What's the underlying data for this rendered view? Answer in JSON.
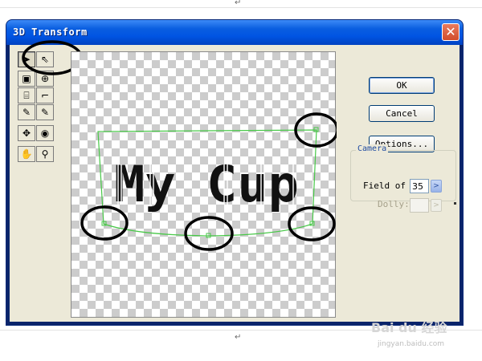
{
  "document": {
    "return_mark_top": "↵",
    "return_mark_bottom": "↵"
  },
  "window": {
    "title": "3D Transform",
    "close_icon": "close-x-icon"
  },
  "toolbox": {
    "tools": [
      {
        "name": "selection-arrow-icon",
        "glyph": "➤",
        "pressed": true
      },
      {
        "name": "direct-select-arrow-icon",
        "glyph": "⇖",
        "pressed": false
      },
      {
        "name": "cube-icon",
        "glyph": "▣",
        "pressed": false
      },
      {
        "name": "sphere-icon",
        "glyph": "⊕",
        "pressed": false
      },
      {
        "name": "cylinder-icon",
        "glyph": "⌸",
        "pressed": false
      },
      {
        "name": "bend-icon",
        "glyph": "⌐",
        "pressed": false
      },
      {
        "name": "pen-add-icon",
        "glyph": "✎",
        "pressed": false
      },
      {
        "name": "pen-remove-icon",
        "glyph": "✎",
        "pressed": false
      },
      {
        "name": "rotate-icon",
        "glyph": "✥",
        "pressed": false
      },
      {
        "name": "orbit-icon",
        "glyph": "◉",
        "pressed": false
      },
      {
        "name": "hand-icon",
        "glyph": "✋",
        "pressed": false
      },
      {
        "name": "zoom-icon",
        "glyph": "⚲",
        "pressed": false
      }
    ]
  },
  "canvas": {
    "text": "My Cup"
  },
  "buttons": {
    "ok": "OK",
    "cancel": "Cancel",
    "options": "Options..."
  },
  "camera": {
    "group_label": "Camera",
    "field_of_view_label": "Field of",
    "field_of_view_value": "35",
    "dolly_label": "Dolly:",
    "dolly_value": ""
  },
  "watermark": {
    "brand": "Bai du 经验",
    "url": "jingyan.baidu.com"
  },
  "colors": {
    "titlebar": "#0054e3",
    "dialog_face": "#ece9d8",
    "bounding_box": "#48c848"
  }
}
